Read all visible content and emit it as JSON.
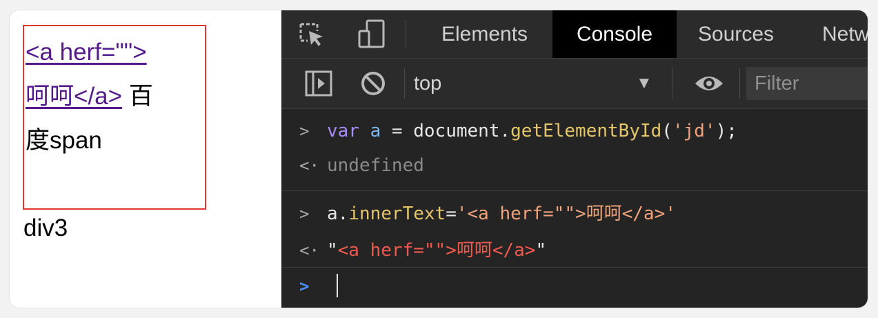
{
  "page": {
    "link_line1": "<a herf=\"\">",
    "link_line2": "呵呵</a>",
    "text_after_link": "百",
    "text_line3": "度span",
    "div3": "div3"
  },
  "devtools": {
    "tabs": [
      {
        "label": "Elements",
        "active": false
      },
      {
        "label": "Console",
        "active": true
      },
      {
        "label": "Sources",
        "active": false
      },
      {
        "label": "Netwo",
        "active": false
      }
    ],
    "toolbar": {
      "context": "top",
      "context_arrow": "▼",
      "filter_placeholder": "Filter"
    },
    "console": {
      "entries": [
        {
          "kind": "input",
          "glyph": ">",
          "parts": {
            "kw": "var",
            "var": "a",
            "eq": " = ",
            "obj": "document.",
            "fn": "getElementById",
            "open": "(",
            "arg": "'jd'",
            "close": ");"
          }
        },
        {
          "kind": "output",
          "glyph": "<·",
          "text": "undefined"
        },
        {
          "kind": "input",
          "glyph": ">",
          "parts": {
            "obj": "a.",
            "prop": "innerText",
            "eq": "=",
            "str": "'<a herf=\"\">呵呵</a>'"
          }
        },
        {
          "kind": "output",
          "glyph": "<·",
          "parts": {
            "q1": "\"",
            "str": "<a herf=\"\">呵呵</a>",
            "q2": "\""
          }
        }
      ],
      "prompt_glyph": ">"
    },
    "icons": {
      "inspect": "inspect-element-icon",
      "device": "device-toolbar-icon",
      "sidebar": "show-sidebar-icon",
      "clear": "clear-console-icon",
      "eye": "live-expression-icon"
    }
  }
}
